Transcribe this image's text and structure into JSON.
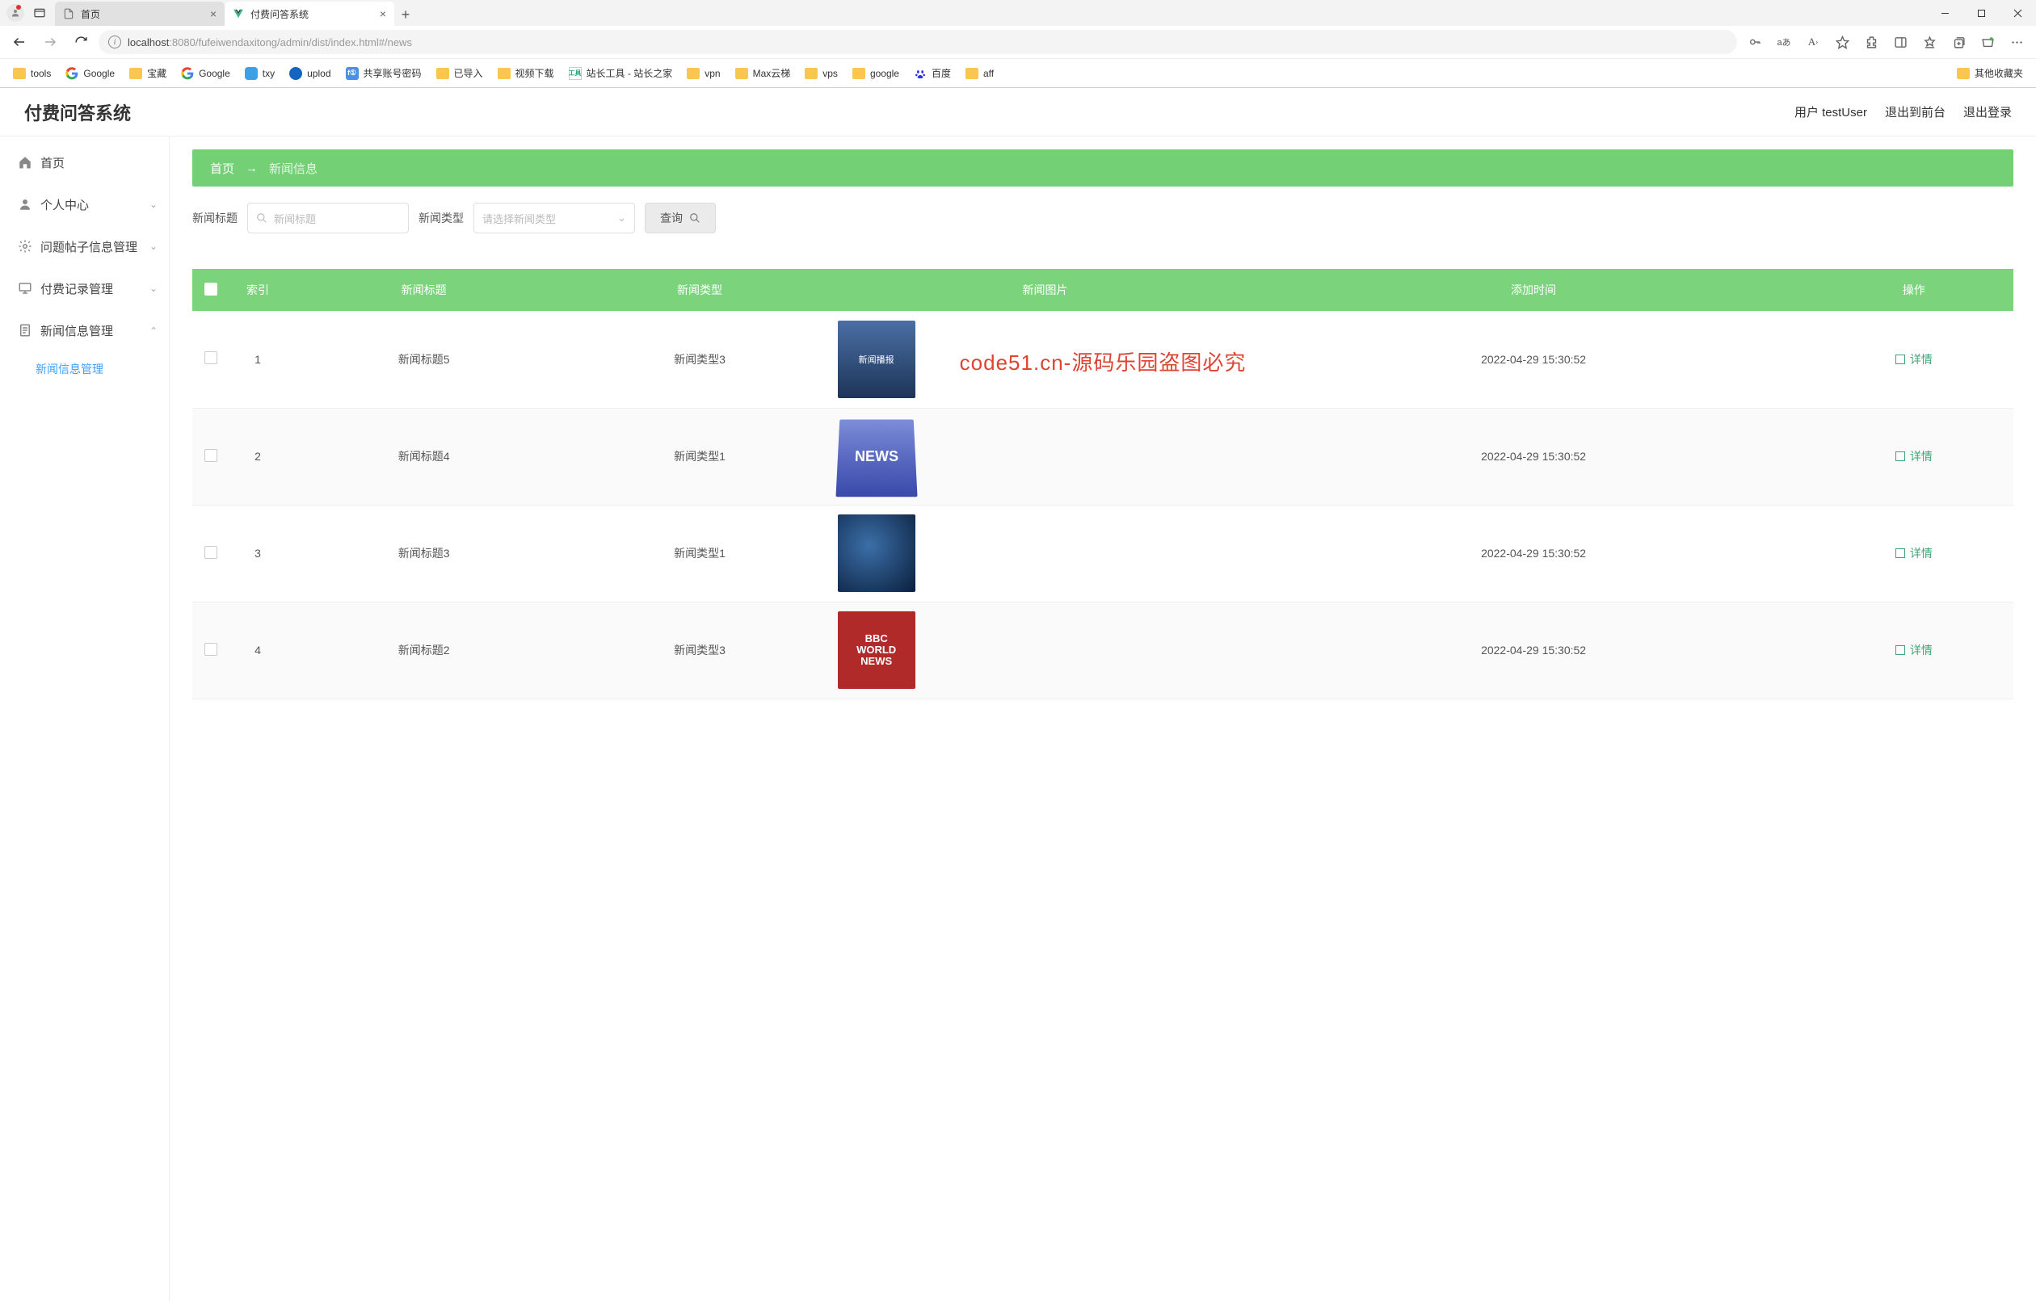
{
  "browser": {
    "tabs": [
      {
        "title": "首页",
        "favicon": "page"
      },
      {
        "title": "付费问答系统",
        "favicon": "vue"
      }
    ],
    "url_host": "localhost",
    "url_rest": ":8080/fufeiwendaxitong/admin/dist/index.html#/news",
    "bookmarks": [
      "tools",
      "Google",
      "宝藏",
      "Google",
      "txy",
      "uplod",
      "共享账号密码",
      "已导入",
      "视频下载",
      "站长工具 - 站长之家",
      "vpn",
      "Max云梯",
      "vps",
      "google",
      "百度",
      "aff"
    ],
    "bookmarks_overflow": "其他收藏夹"
  },
  "header": {
    "app_title": "付费问答系统",
    "user_label": "用户 testUser",
    "to_front": "退出到前台",
    "logout": "退出登录"
  },
  "sidebar": {
    "items": [
      {
        "label": "首页",
        "icon": "home"
      },
      {
        "label": "个人中心",
        "icon": "user",
        "chev": true
      },
      {
        "label": "问题帖子信息管理",
        "icon": "gear",
        "chev": true
      },
      {
        "label": "付费记录管理",
        "icon": "monitor",
        "chev": true
      },
      {
        "label": "新闻信息管理",
        "icon": "doc",
        "chev": true,
        "expanded": true
      }
    ],
    "submenu": {
      "label": "新闻信息管理"
    }
  },
  "breadcrumb": {
    "home": "首页",
    "sep": "→",
    "current": "新闻信息"
  },
  "filters": {
    "title_label": "新闻标题",
    "title_placeholder": "新闻标题",
    "type_label": "新闻类型",
    "type_placeholder": "请选择新闻类型",
    "search_btn": "查询"
  },
  "table": {
    "columns": [
      "",
      "索引",
      "新闻标题",
      "新闻类型",
      "新闻图片",
      "添加时间",
      "操作"
    ],
    "detail_label": "详情",
    "rows": [
      {
        "idx": "1",
        "title": "新闻标题5",
        "type": "新闻类型3",
        "thumb": "report",
        "thumb_text": "新闻播报",
        "time": "2022-04-29 15:30:52"
      },
      {
        "idx": "2",
        "title": "新闻标题4",
        "type": "新闻类型1",
        "thumb": "blue-news",
        "thumb_text": "NEWS",
        "time": "2022-04-29 15:30:52"
      },
      {
        "idx": "3",
        "title": "新闻标题3",
        "type": "新闻类型1",
        "thumb": "globe",
        "thumb_text": "",
        "time": "2022-04-29 15:30:52"
      },
      {
        "idx": "4",
        "title": "新闻标题2",
        "type": "新闻类型3",
        "thumb": "bbc",
        "thumb_text": "BBC|WORLD|NEWS",
        "time": "2022-04-29 15:30:52"
      }
    ]
  },
  "watermark": "code51.cn-源码乐园盗图必究"
}
